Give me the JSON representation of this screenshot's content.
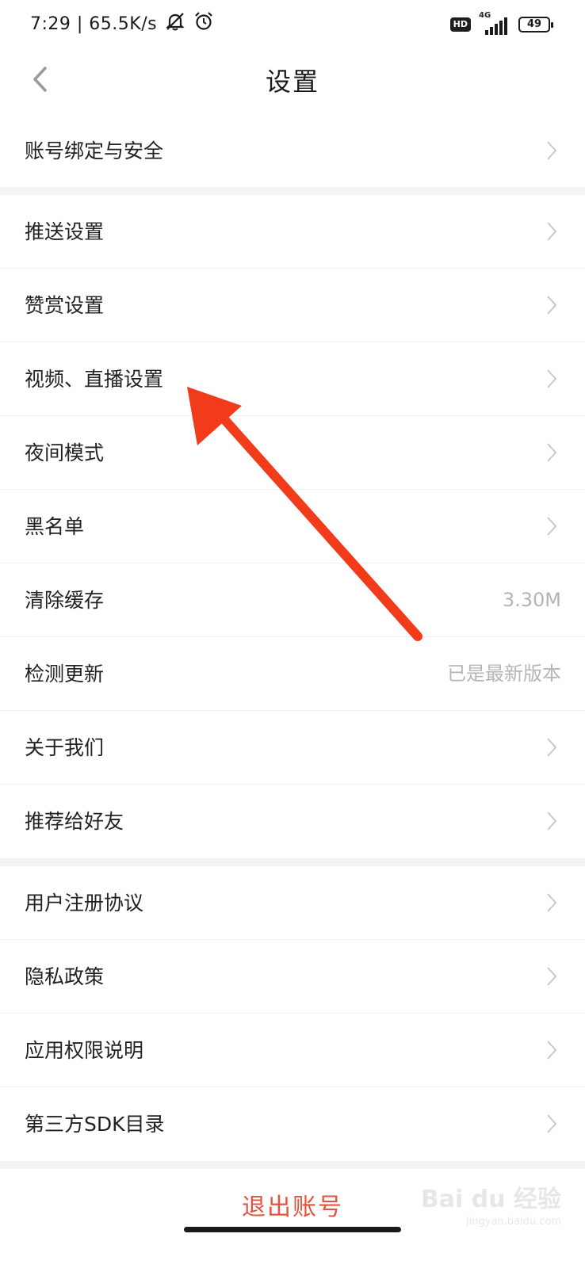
{
  "status_bar": {
    "time_speed": "7:29 | 65.5K/s",
    "hd": "HD",
    "network": "4G",
    "battery": "49"
  },
  "header": {
    "title": "设置"
  },
  "groups": [
    {
      "items": [
        {
          "label": "账号绑定与安全"
        }
      ]
    },
    {
      "items": [
        {
          "label": "推送设置"
        },
        {
          "label": "赞赏设置"
        },
        {
          "label": "视频、直播设置"
        },
        {
          "label": "夜间模式"
        },
        {
          "label": "黑名单"
        },
        {
          "label": "清除缓存",
          "value": "3.30M"
        },
        {
          "label": "检测更新",
          "value": "已是最新版本"
        },
        {
          "label": "关于我们"
        },
        {
          "label": "推荐给好友"
        }
      ]
    },
    {
      "items": [
        {
          "label": "用户注册协议"
        },
        {
          "label": "隐私政策"
        },
        {
          "label": "应用权限说明"
        },
        {
          "label": "第三方SDK目录"
        }
      ]
    }
  ],
  "logout_label": "退出账号",
  "watermark": {
    "brand": "Bai du 经验",
    "url": "jingyan.baidu.com"
  },
  "colors": {
    "accent_red": "#e4533f",
    "arrow_red": "#f23b1a",
    "secondary_text": "#b5b5b5",
    "divider_bg": "#f4f4f4"
  }
}
